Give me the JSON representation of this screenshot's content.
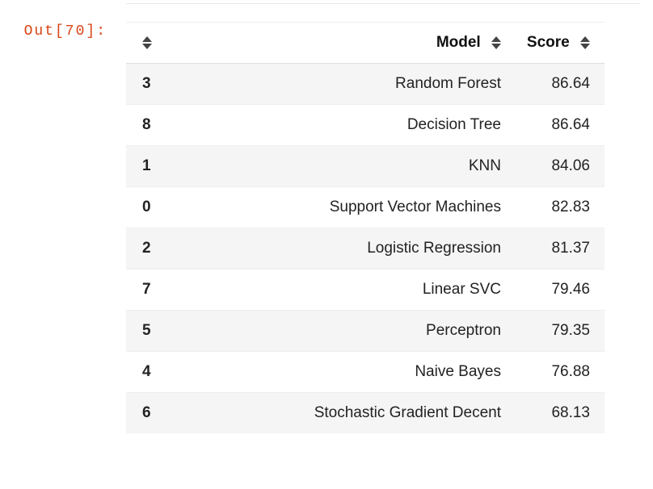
{
  "prompt": "Out[70]:",
  "columns": {
    "index": "",
    "model": "Model",
    "score": "Score"
  },
  "rows": [
    {
      "index": "3",
      "model": "Random Forest",
      "score": "86.64"
    },
    {
      "index": "8",
      "model": "Decision Tree",
      "score": "86.64"
    },
    {
      "index": "1",
      "model": "KNN",
      "score": "84.06"
    },
    {
      "index": "0",
      "model": "Support Vector Machines",
      "score": "82.83"
    },
    {
      "index": "2",
      "model": "Logistic Regression",
      "score": "81.37"
    },
    {
      "index": "7",
      "model": "Linear SVC",
      "score": "79.46"
    },
    {
      "index": "5",
      "model": "Perceptron",
      "score": "79.35"
    },
    {
      "index": "4",
      "model": "Naive Bayes",
      "score": "76.88"
    },
    {
      "index": "6",
      "model": "Stochastic Gradient Decent",
      "score": "68.13"
    }
  ]
}
